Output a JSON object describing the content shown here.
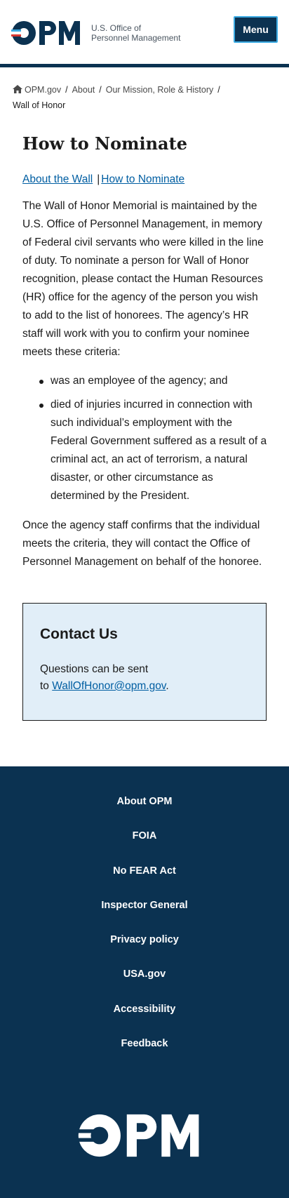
{
  "header": {
    "agency_line1": "U.S. Office of",
    "agency_line2": "Personnel Management",
    "menu_label": "Menu",
    "logo_text": "OPM"
  },
  "breadcrumb": {
    "items": [
      "OPM.gov",
      "About",
      "Our Mission, Role & History"
    ],
    "current": "Wall of Honor",
    "separator": "/"
  },
  "main": {
    "title": "How to Nominate",
    "sublinks": [
      "About the Wall",
      "How to Nominate"
    ],
    "intro": "The Wall of Honor Memorial is maintained by the U.S. Office of Personnel Management, in memory of Federal civil servants who were killed in the line of duty. To nominate a person for Wall of Honor recognition, please contact the Human Resources (HR) office for the agency of the person you wish to add to the list of honorees. The agency’s HR staff will work with you to confirm your nominee meets these criteria:",
    "criteria": [
      "was an employee of the agency; and",
      "died of injuries incurred in connection with such individual’s employment with the Federal Government suffered as a result of a criminal act, an act of terrorism, a natural disaster, or other circumstance as determined by the President."
    ],
    "closing": "Once the agency staff confirms that the individual meets the criteria, they will contact the Office of Personnel Management on behalf of the honoree."
  },
  "contact": {
    "heading": "Contact Us",
    "text_line1": "Questions can be sent",
    "text_to": "to ",
    "email": "WallOfHonor@opm.gov",
    "text_end": "."
  },
  "footer": {
    "links": [
      "About OPM",
      "FOIA",
      "No FEAR Act",
      "Inspector General",
      "Privacy policy",
      "USA.gov",
      "Accessibility",
      "Feedback"
    ],
    "logo_text": "OPM"
  },
  "colors": {
    "navy": "#0b3251",
    "link": "#005ea2",
    "accent_blue": "#3aaae3",
    "accent_red": "#d83933",
    "contact_bg": "#e1eef8"
  }
}
